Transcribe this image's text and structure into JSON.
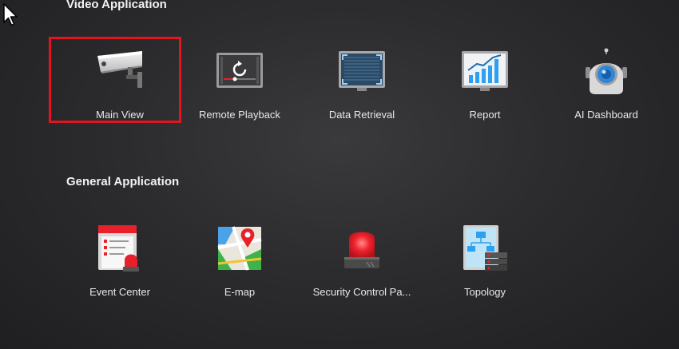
{
  "sections": {
    "video": {
      "title": "Video Application",
      "items": [
        {
          "label": "Main View",
          "icon": "camera-icon",
          "selected": true
        },
        {
          "label": "Remote Playback",
          "icon": "playback-icon"
        },
        {
          "label": "Data Retrieval",
          "icon": "data-retrieval-icon"
        },
        {
          "label": "Report",
          "icon": "report-chart-icon"
        },
        {
          "label": "AI Dashboard",
          "icon": "robot-icon"
        }
      ]
    },
    "general": {
      "title": "General Application",
      "items": [
        {
          "label": "Event Center",
          "icon": "event-center-icon"
        },
        {
          "label": "E-map",
          "icon": "map-pin-icon"
        },
        {
          "label": "Security Control Pa...",
          "icon": "alarm-light-icon"
        },
        {
          "label": "Topology",
          "icon": "topology-icon"
        }
      ]
    }
  },
  "colors": {
    "selection": "#e3141d",
    "accent_blue": "#2ea0f2",
    "alarm_red": "#e8202a"
  }
}
